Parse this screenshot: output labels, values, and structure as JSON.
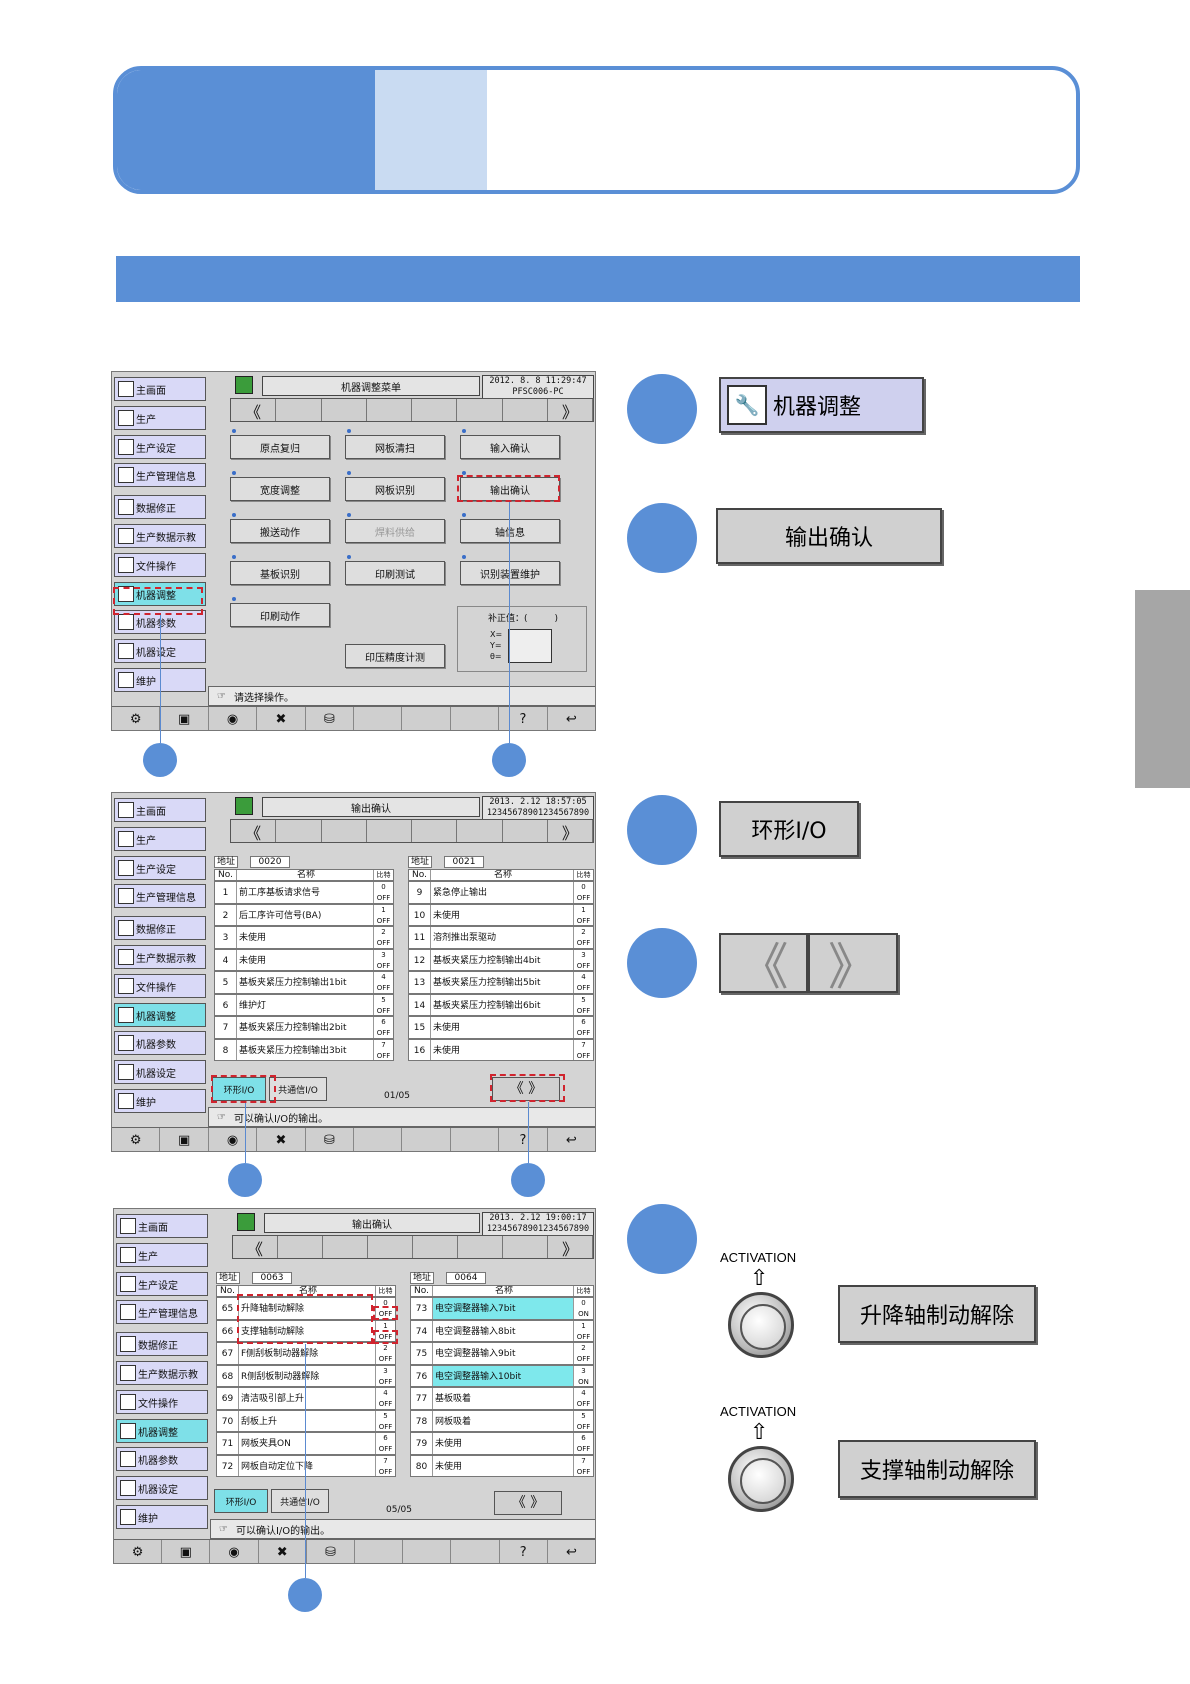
{
  "menu1": {
    "title": "机器调整菜单",
    "clock": [
      "2012. 8. 8 11:29:47",
      "PFSC006-PC"
    ],
    "sidebar": [
      "主画面",
      "生产",
      "生产设定",
      "生产管理信息",
      "数据修正",
      "生产数据示教",
      "文件操作",
      "机器调整",
      "机器参数",
      "机器设定",
      "维护"
    ],
    "buttons": [
      "原点复归",
      "网板清扫",
      "输入确认",
      "宽度调整",
      "网板识别",
      "输出确认",
      "搬送动作",
      "焊料供给",
      "轴信息",
      "基板识别",
      "印刷测试",
      "识别装置维护",
      "印刷动作",
      "印压精度计测"
    ],
    "offset_label": "补正值：(　　　)",
    "xyz": [
      "X=",
      "Y=",
      "θ="
    ],
    "status": "请选择操作。"
  },
  "screen2": {
    "title": "输出确认",
    "clock": [
      "2013. 2.12 18:57:05",
      "12345678901234567890"
    ],
    "addr_label": "地址",
    "addr_left": "0020",
    "addr_right": "0021",
    "col_no": "No.",
    "col_name": "名称",
    "col_bit": "比特",
    "left_rows": [
      {
        "no": "1",
        "name": "前工序基板请求信号",
        "bit": "0",
        "val": "OFF"
      },
      {
        "no": "2",
        "name": "后工序许可信号(BA)",
        "bit": "1",
        "val": "OFF"
      },
      {
        "no": "3",
        "name": "未使用",
        "bit": "2",
        "val": "OFF"
      },
      {
        "no": "4",
        "name": "未使用",
        "bit": "3",
        "val": "OFF"
      },
      {
        "no": "5",
        "name": "基板夹紧压力控制输出1bit",
        "bit": "4",
        "val": "OFF"
      },
      {
        "no": "6",
        "name": "维护灯",
        "bit": "5",
        "val": "OFF"
      },
      {
        "no": "7",
        "name": "基板夹紧压力控制输出2bit",
        "bit": "6",
        "val": "OFF"
      },
      {
        "no": "8",
        "name": "基板夹紧压力控制输出3bit",
        "bit": "7",
        "val": "OFF"
      }
    ],
    "right_rows": [
      {
        "no": "9",
        "name": "紧急停止输出",
        "bit": "0",
        "val": "OFF"
      },
      {
        "no": "10",
        "name": "未使用",
        "bit": "1",
        "val": "OFF"
      },
      {
        "no": "11",
        "name": "溶剂推出泵驱动",
        "bit": "2",
        "val": "OFF"
      },
      {
        "no": "12",
        "name": "基板夹紧压力控制输出4bit",
        "bit": "3",
        "val": "OFF"
      },
      {
        "no": "13",
        "name": "基板夹紧压力控制输出5bit",
        "bit": "4",
        "val": "OFF"
      },
      {
        "no": "14",
        "name": "基板夹紧压力控制输出6bit",
        "bit": "5",
        "val": "OFF"
      },
      {
        "no": "15",
        "name": "未使用",
        "bit": "6",
        "val": "OFF"
      },
      {
        "no": "16",
        "name": "未使用",
        "bit": "7",
        "val": "OFF"
      }
    ],
    "tab1": "环形I/O",
    "tab2": "共通信I/O",
    "page": "01/05",
    "status": "可以确认I/O的输出。"
  },
  "screen3": {
    "title": "输出确认",
    "clock": [
      "2013. 2.12 19:00:17",
      "12345678901234567890"
    ],
    "addr_left": "0063",
    "addr_right": "0064",
    "left_rows": [
      {
        "no": "65",
        "name": "升降轴制动解除",
        "bit": "0",
        "val": "OFF"
      },
      {
        "no": "66",
        "name": "支撑轴制动解除",
        "bit": "1",
        "val": "OFF"
      },
      {
        "no": "67",
        "name": "F侧刮板制动器解除",
        "bit": "2",
        "val": "OFF"
      },
      {
        "no": "68",
        "name": "R侧刮板制动器解除",
        "bit": "3",
        "val": "OFF"
      },
      {
        "no": "69",
        "name": "清洁吸引部上升",
        "bit": "4",
        "val": "OFF"
      },
      {
        "no": "70",
        "name": "刮板上升",
        "bit": "5",
        "val": "OFF"
      },
      {
        "no": "71",
        "name": "网板夹具ON",
        "bit": "6",
        "val": "OFF"
      },
      {
        "no": "72",
        "name": "网板自动定位下降",
        "bit": "7",
        "val": "OFF"
      }
    ],
    "right_rows": [
      {
        "no": "73",
        "name": "电空调整器输入7bit",
        "bit": "0",
        "val": "ON",
        "cyan": true
      },
      {
        "no": "74",
        "name": "电空调整器输入8bit",
        "bit": "1",
        "val": "OFF"
      },
      {
        "no": "75",
        "name": "电空调整器输入9bit",
        "bit": "2",
        "val": "OFF"
      },
      {
        "no": "76",
        "name": "电空调整器输入10bit",
        "bit": "3",
        "val": "ON",
        "cyan": true
      },
      {
        "no": "77",
        "name": "基板吸着",
        "bit": "4",
        "val": "OFF"
      },
      {
        "no": "78",
        "name": "网板吸着",
        "bit": "5",
        "val": "OFF"
      },
      {
        "no": "79",
        "name": "未使用",
        "bit": "6",
        "val": "OFF"
      },
      {
        "no": "80",
        "name": "未使用",
        "bit": "7",
        "val": "OFF"
      }
    ],
    "page": "05/05",
    "status": "可以确认I/O的输出。"
  },
  "right": {
    "btn_adjust": "机器调整",
    "btn_output": "输出确认",
    "btn_ring": "环形I/O",
    "activation": "ACTIVATION",
    "btn_lift": "升降轴制动解除",
    "btn_support": "支撑轴制动解除"
  },
  "colors": {
    "accent": "#5a8fd6",
    "light": "#c9dbf2",
    "highlight": "#7ee0e8",
    "redline": "#d0242e"
  }
}
